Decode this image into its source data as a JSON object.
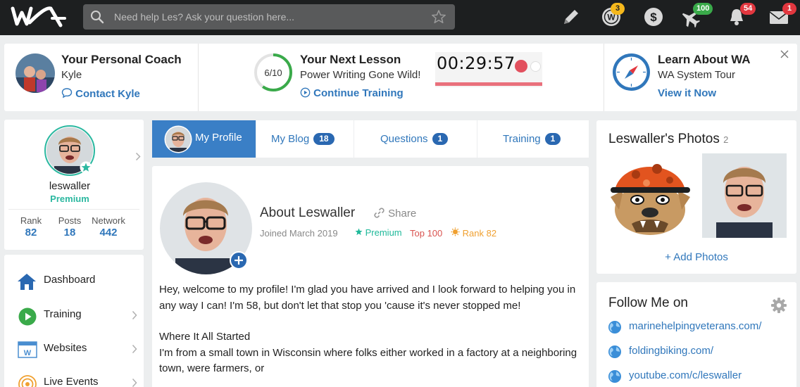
{
  "search": {
    "placeholder": "Need help Les? Ask your question here..."
  },
  "topbar": {
    "badges": {
      "wa_credits": "3",
      "airplane": "100",
      "notifications": "54",
      "messages": "1"
    }
  },
  "coach": {
    "title": "Your Personal Coach",
    "name": "Kyle",
    "link": "Contact Kyle"
  },
  "lesson": {
    "progress_text": "6/10",
    "progress_fraction": 0.6,
    "title": "Your Next Lesson",
    "name": "Power Writing Gone Wild!",
    "link": "Continue Training",
    "timer": "00:29:57"
  },
  "learn": {
    "title": "Learn About WA",
    "sub": "WA System Tour",
    "link": "View it Now"
  },
  "profile": {
    "username": "leswaller",
    "membership": "Premium",
    "stats": [
      {
        "label": "Rank",
        "value": "82"
      },
      {
        "label": "Posts",
        "value": "18"
      },
      {
        "label": "Network",
        "value": "442"
      }
    ]
  },
  "nav": [
    {
      "label": "Dashboard"
    },
    {
      "label": "Training"
    },
    {
      "label": "Websites"
    },
    {
      "label": "Live Events"
    }
  ],
  "tabs": [
    {
      "label": "My Profile"
    },
    {
      "label": "My Blog",
      "badge": "18"
    },
    {
      "label": "Questions",
      "badge": "1"
    },
    {
      "label": "Training",
      "badge": "1"
    }
  ],
  "about": {
    "title": "About Leswaller",
    "share": "Share",
    "joined": "Joined March 2019",
    "premium": "Premium",
    "top": "Top 100",
    "rank": "Rank 82",
    "p1": "Hey, welcome to my profile! I'm glad you have arrived and I look forward to helping you in any way I can! I'm 58, but don't let that stop you 'cause it's never stopped me!",
    "p2_title": "Where It All Started",
    "p2": "I'm from a small town in Wisconsin where folks either worked in a factory at a neighboring town, were farmers, or"
  },
  "photos": {
    "title": "Leswaller's Photos",
    "count": "2",
    "add": "+ Add Photos"
  },
  "follow": {
    "title": "Follow Me on",
    "links": [
      "marinehelpingveterans.com/",
      "foldingbiking.com/",
      "youtube.com/c/leswaller"
    ]
  },
  "colors": {
    "brand_blue": "#3077bb",
    "premium_teal": "#1fb99a",
    "top_red": "#d9534f",
    "rank_orange": "#f0a030",
    "badge_red": "#e2373f",
    "badge_green": "#3aaa4a",
    "badge_yellow": "#f5b81c"
  }
}
